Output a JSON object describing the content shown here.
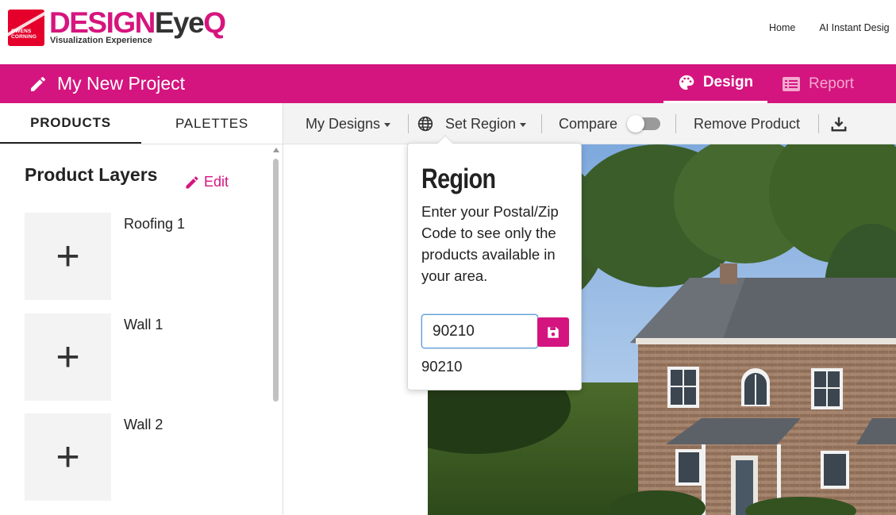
{
  "brand": {
    "badge_text_line1": "OWENS",
    "badge_text_line2": "CORNING",
    "name_design": "DESIGN",
    "name_eye": "Eye",
    "name_q": "Q",
    "tagline": "Visualization Experience"
  },
  "top_nav": {
    "items": [
      "Home",
      "AI Instant Desig"
    ]
  },
  "project": {
    "title": "My New Project"
  },
  "mode_tabs": {
    "design": "Design",
    "report": "Report"
  },
  "left_tabs": {
    "products": "PRODUCTS",
    "palettes": "PALETTES"
  },
  "layers": {
    "heading": "Product Layers",
    "edit_label": "Edit",
    "items": [
      {
        "name": "Roofing 1",
        "add_glyph": "+"
      },
      {
        "name": "Wall 1",
        "add_glyph": "+"
      },
      {
        "name": "Wall 2",
        "add_glyph": "+"
      }
    ]
  },
  "toolbar": {
    "my_designs": "My Designs",
    "set_region": "Set Region",
    "compare": "Compare",
    "compare_enabled": false,
    "remove_product": "Remove Product"
  },
  "region_popover": {
    "title": "Region",
    "body": "Enter your Postal/Zip Code to see only the products available in your area.",
    "zip_value": "90210",
    "zip_echo": "90210"
  },
  "colors": {
    "brand_magenta": "#d4157f",
    "toggle_off": "#9a9a9a"
  },
  "icons": {
    "project_edit": "pencil-icon",
    "design_tab": "palette-icon",
    "report_tab": "list-icon",
    "set_region": "globe-icon",
    "download": "download-icon",
    "save": "floppy-disk-icon"
  }
}
